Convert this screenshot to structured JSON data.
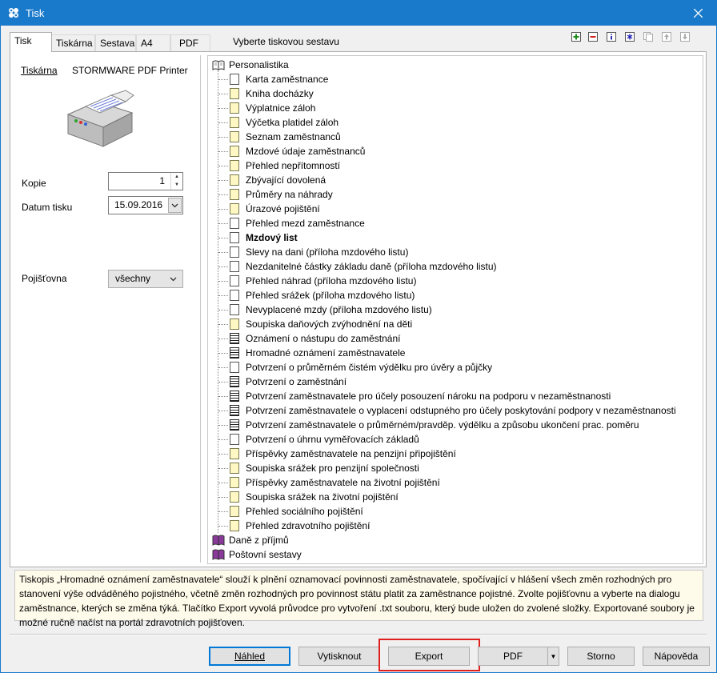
{
  "window": {
    "title": "Tisk"
  },
  "tabs": [
    {
      "label": "Tisk",
      "active": true
    },
    {
      "label": "Tiskárna",
      "active": false
    },
    {
      "label": "Sestava",
      "active": false
    },
    {
      "label": "A4",
      "active": false
    },
    {
      "label": "PDF",
      "active": false
    }
  ],
  "header": {
    "select_label": "Vyberte tiskovou sestavu"
  },
  "toolbar": {
    "add_icon": "plus-icon",
    "remove_icon": "minus-icon",
    "info_icon": "info-icon",
    "star_icon": "asterisk-icon",
    "copy_icon": "copy-icon",
    "up_icon": "arrow-up-icon",
    "down_icon": "arrow-down-icon"
  },
  "printer": {
    "label": "Tiskárna",
    "name": "STORMWARE PDF Printer"
  },
  "copies": {
    "label": "Kopie",
    "value": "1"
  },
  "print_date": {
    "label": "Datum tisku",
    "value": "15.09.2016"
  },
  "insurer": {
    "label": "Pojišťovna",
    "value": "všechny"
  },
  "tree": {
    "root": "Personalistika",
    "items": [
      {
        "label": "Karta zaměstnance",
        "icon": "white",
        "bold": false
      },
      {
        "label": "Kniha docházky",
        "icon": "yellow",
        "bold": false
      },
      {
        "label": "Výplatnice záloh",
        "icon": "yellow",
        "bold": false
      },
      {
        "label": "Výčetka platidel záloh",
        "icon": "yellow",
        "bold": false
      },
      {
        "label": "Seznam zaměstnanců",
        "icon": "yellow",
        "bold": false
      },
      {
        "label": "Mzdové údaje zaměstnanců",
        "icon": "yellow",
        "bold": false
      },
      {
        "label": "Přehled nepřítomností",
        "icon": "yellow",
        "bold": false
      },
      {
        "label": "Zbývající dovolená",
        "icon": "yellow",
        "bold": false
      },
      {
        "label": "Průměry na náhrady",
        "icon": "yellow",
        "bold": false
      },
      {
        "label": "Úrazové pojištění",
        "icon": "yellow",
        "bold": false
      },
      {
        "label": "Přehled mezd zaměstnance",
        "icon": "white",
        "bold": false
      },
      {
        "label": "Mzdový list",
        "icon": "white",
        "bold": true
      },
      {
        "label": "Slevy na dani (příloha mzdového listu)",
        "icon": "white",
        "bold": false
      },
      {
        "label": "Nezdanitelné částky základu daně (příloha mzdového listu)",
        "icon": "white",
        "bold": false
      },
      {
        "label": "Přehled náhrad (příloha mzdového listu)",
        "icon": "white",
        "bold": false
      },
      {
        "label": "Přehled srážek (příloha mzdového listu)",
        "icon": "white",
        "bold": false
      },
      {
        "label": "Nevyplacené mzdy (příloha mzdového listu)",
        "icon": "white",
        "bold": false
      },
      {
        "label": "Soupiska daňových zvýhodnění na děti",
        "icon": "yellow",
        "bold": false
      },
      {
        "label": "Oznámení o nástupu do zaměstnání",
        "icon": "lines",
        "bold": false
      },
      {
        "label": "Hromadné oznámení zaměstnavatele",
        "icon": "lines",
        "bold": false
      },
      {
        "label": "Potvrzení o průměrném čistém výdělku pro úvěry a půjčky",
        "icon": "white",
        "bold": false
      },
      {
        "label": "Potvrzení o zaměstnání",
        "icon": "lines",
        "bold": false
      },
      {
        "label": "Potvrzení zaměstnavatele pro účely posouzení nároku na podporu v nezaměstnanosti",
        "icon": "lines",
        "bold": false
      },
      {
        "label": "Potvrzení zaměstnavatele o vyplacení odstupného pro účely poskytování podpory v nezaměstnanosti",
        "icon": "lines",
        "bold": false
      },
      {
        "label": "Potvrzení zaměstnavatele o průměrném/pravděp. výdělku a způsobu ukončení prac. poměru",
        "icon": "lines",
        "bold": false
      },
      {
        "label": "Potvrzení o úhrnu vyměřovacích základů",
        "icon": "white",
        "bold": false
      },
      {
        "label": "Příspěvky zaměstnavatele na penzijní připojištění",
        "icon": "yellow",
        "bold": false
      },
      {
        "label": "Soupiska srážek pro penzijní společnosti",
        "icon": "yellow",
        "bold": false
      },
      {
        "label": "Příspěvky zaměstnavatele na životní pojištění",
        "icon": "yellow",
        "bold": false
      },
      {
        "label": "Soupiska srážek na životní pojištění",
        "icon": "yellow",
        "bold": false
      },
      {
        "label": "Přehled sociálního pojištění",
        "icon": "yellow",
        "bold": false
      },
      {
        "label": "Přehled zdravotního pojištění",
        "icon": "yellow",
        "bold": false
      }
    ],
    "groups": [
      "Daně z příjmů",
      "Poštovní sestavy"
    ]
  },
  "info_text": "Tiskopis „Hromadné oznámení zaměstnavatele“ slouží k plnění oznamovací povinnosti zaměstnavatele, spočívající v hlášení všech změn rozhodných pro stanovení výše odváděného pojistného, včetně změn rozhodných pro povinnost státu platit za zaměstnance pojistné. Zvolte pojišťovnu a vyberte na dialogu zaměstnance, kterých se změna týká. Tlačítko Export vyvolá průvodce pro vytvoření .txt souboru, který bude uložen do zvolené složky. Exportované soubory je možné ručně načíst na portál zdravotních pojišťoven.",
  "buttons": {
    "preview": "Náhled",
    "print": "Vytisknout",
    "export": "Export",
    "pdf": "PDF",
    "cancel": "Storno",
    "help": "Nápověda"
  },
  "colors": {
    "titlebar": "#1979ca",
    "highlight": "#e0201e",
    "info_bg": "#fffbea"
  }
}
